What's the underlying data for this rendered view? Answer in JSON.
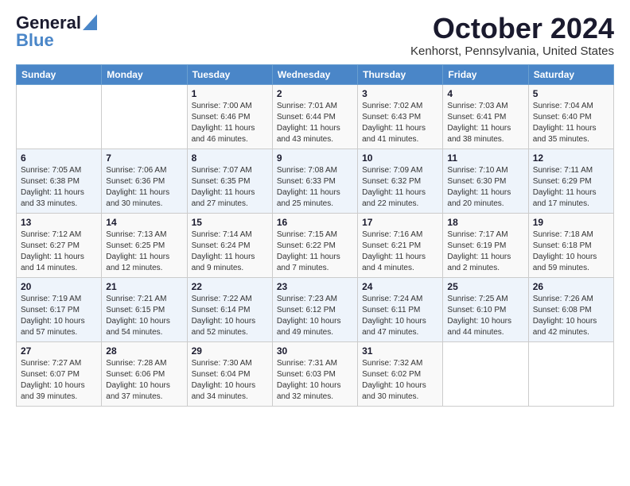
{
  "header": {
    "logo_line1": "General",
    "logo_line2": "Blue",
    "month": "October 2024",
    "location": "Kenhorst, Pennsylvania, United States"
  },
  "days_of_week": [
    "Sunday",
    "Monday",
    "Tuesday",
    "Wednesday",
    "Thursday",
    "Friday",
    "Saturday"
  ],
  "weeks": [
    [
      {
        "day": "",
        "sunrise": "",
        "sunset": "",
        "daylight": ""
      },
      {
        "day": "",
        "sunrise": "",
        "sunset": "",
        "daylight": ""
      },
      {
        "day": "1",
        "sunrise": "Sunrise: 7:00 AM",
        "sunset": "Sunset: 6:46 PM",
        "daylight": "Daylight: 11 hours and 46 minutes."
      },
      {
        "day": "2",
        "sunrise": "Sunrise: 7:01 AM",
        "sunset": "Sunset: 6:44 PM",
        "daylight": "Daylight: 11 hours and 43 minutes."
      },
      {
        "day": "3",
        "sunrise": "Sunrise: 7:02 AM",
        "sunset": "Sunset: 6:43 PM",
        "daylight": "Daylight: 11 hours and 41 minutes."
      },
      {
        "day": "4",
        "sunrise": "Sunrise: 7:03 AM",
        "sunset": "Sunset: 6:41 PM",
        "daylight": "Daylight: 11 hours and 38 minutes."
      },
      {
        "day": "5",
        "sunrise": "Sunrise: 7:04 AM",
        "sunset": "Sunset: 6:40 PM",
        "daylight": "Daylight: 11 hours and 35 minutes."
      }
    ],
    [
      {
        "day": "6",
        "sunrise": "Sunrise: 7:05 AM",
        "sunset": "Sunset: 6:38 PM",
        "daylight": "Daylight: 11 hours and 33 minutes."
      },
      {
        "day": "7",
        "sunrise": "Sunrise: 7:06 AM",
        "sunset": "Sunset: 6:36 PM",
        "daylight": "Daylight: 11 hours and 30 minutes."
      },
      {
        "day": "8",
        "sunrise": "Sunrise: 7:07 AM",
        "sunset": "Sunset: 6:35 PM",
        "daylight": "Daylight: 11 hours and 27 minutes."
      },
      {
        "day": "9",
        "sunrise": "Sunrise: 7:08 AM",
        "sunset": "Sunset: 6:33 PM",
        "daylight": "Daylight: 11 hours and 25 minutes."
      },
      {
        "day": "10",
        "sunrise": "Sunrise: 7:09 AM",
        "sunset": "Sunset: 6:32 PM",
        "daylight": "Daylight: 11 hours and 22 minutes."
      },
      {
        "day": "11",
        "sunrise": "Sunrise: 7:10 AM",
        "sunset": "Sunset: 6:30 PM",
        "daylight": "Daylight: 11 hours and 20 minutes."
      },
      {
        "day": "12",
        "sunrise": "Sunrise: 7:11 AM",
        "sunset": "Sunset: 6:29 PM",
        "daylight": "Daylight: 11 hours and 17 minutes."
      }
    ],
    [
      {
        "day": "13",
        "sunrise": "Sunrise: 7:12 AM",
        "sunset": "Sunset: 6:27 PM",
        "daylight": "Daylight: 11 hours and 14 minutes."
      },
      {
        "day": "14",
        "sunrise": "Sunrise: 7:13 AM",
        "sunset": "Sunset: 6:25 PM",
        "daylight": "Daylight: 11 hours and 12 minutes."
      },
      {
        "day": "15",
        "sunrise": "Sunrise: 7:14 AM",
        "sunset": "Sunset: 6:24 PM",
        "daylight": "Daylight: 11 hours and 9 minutes."
      },
      {
        "day": "16",
        "sunrise": "Sunrise: 7:15 AM",
        "sunset": "Sunset: 6:22 PM",
        "daylight": "Daylight: 11 hours and 7 minutes."
      },
      {
        "day": "17",
        "sunrise": "Sunrise: 7:16 AM",
        "sunset": "Sunset: 6:21 PM",
        "daylight": "Daylight: 11 hours and 4 minutes."
      },
      {
        "day": "18",
        "sunrise": "Sunrise: 7:17 AM",
        "sunset": "Sunset: 6:19 PM",
        "daylight": "Daylight: 11 hours and 2 minutes."
      },
      {
        "day": "19",
        "sunrise": "Sunrise: 7:18 AM",
        "sunset": "Sunset: 6:18 PM",
        "daylight": "Daylight: 10 hours and 59 minutes."
      }
    ],
    [
      {
        "day": "20",
        "sunrise": "Sunrise: 7:19 AM",
        "sunset": "Sunset: 6:17 PM",
        "daylight": "Daylight: 10 hours and 57 minutes."
      },
      {
        "day": "21",
        "sunrise": "Sunrise: 7:21 AM",
        "sunset": "Sunset: 6:15 PM",
        "daylight": "Daylight: 10 hours and 54 minutes."
      },
      {
        "day": "22",
        "sunrise": "Sunrise: 7:22 AM",
        "sunset": "Sunset: 6:14 PM",
        "daylight": "Daylight: 10 hours and 52 minutes."
      },
      {
        "day": "23",
        "sunrise": "Sunrise: 7:23 AM",
        "sunset": "Sunset: 6:12 PM",
        "daylight": "Daylight: 10 hours and 49 minutes."
      },
      {
        "day": "24",
        "sunrise": "Sunrise: 7:24 AM",
        "sunset": "Sunset: 6:11 PM",
        "daylight": "Daylight: 10 hours and 47 minutes."
      },
      {
        "day": "25",
        "sunrise": "Sunrise: 7:25 AM",
        "sunset": "Sunset: 6:10 PM",
        "daylight": "Daylight: 10 hours and 44 minutes."
      },
      {
        "day": "26",
        "sunrise": "Sunrise: 7:26 AM",
        "sunset": "Sunset: 6:08 PM",
        "daylight": "Daylight: 10 hours and 42 minutes."
      }
    ],
    [
      {
        "day": "27",
        "sunrise": "Sunrise: 7:27 AM",
        "sunset": "Sunset: 6:07 PM",
        "daylight": "Daylight: 10 hours and 39 minutes."
      },
      {
        "day": "28",
        "sunrise": "Sunrise: 7:28 AM",
        "sunset": "Sunset: 6:06 PM",
        "daylight": "Daylight: 10 hours and 37 minutes."
      },
      {
        "day": "29",
        "sunrise": "Sunrise: 7:30 AM",
        "sunset": "Sunset: 6:04 PM",
        "daylight": "Daylight: 10 hours and 34 minutes."
      },
      {
        "day": "30",
        "sunrise": "Sunrise: 7:31 AM",
        "sunset": "Sunset: 6:03 PM",
        "daylight": "Daylight: 10 hours and 32 minutes."
      },
      {
        "day": "31",
        "sunrise": "Sunrise: 7:32 AM",
        "sunset": "Sunset: 6:02 PM",
        "daylight": "Daylight: 10 hours and 30 minutes."
      },
      {
        "day": "",
        "sunrise": "",
        "sunset": "",
        "daylight": ""
      },
      {
        "day": "",
        "sunrise": "",
        "sunset": "",
        "daylight": ""
      }
    ]
  ]
}
